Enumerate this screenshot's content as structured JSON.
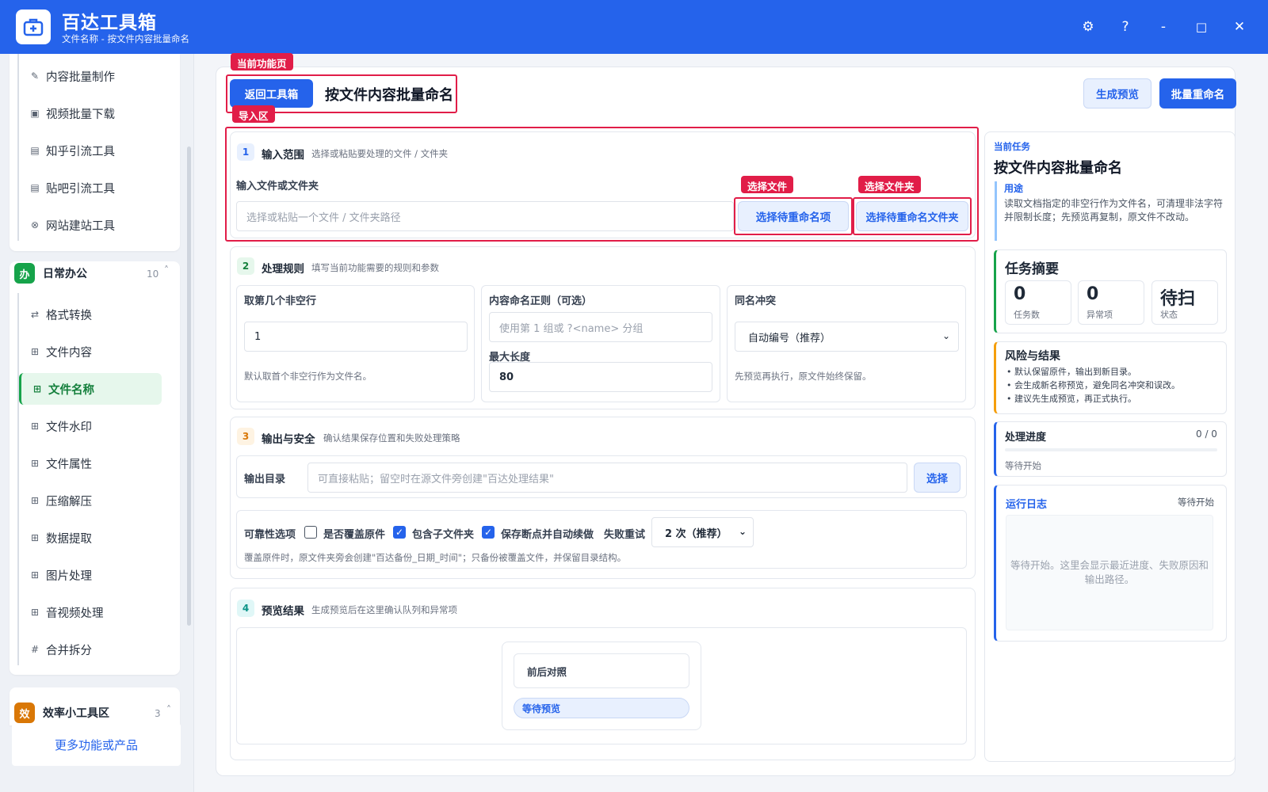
{
  "app": {
    "title": "百达工具箱",
    "subtitle": "文件名称 - 按文件内容批量命名"
  },
  "window_controls": {
    "settings": "⚙",
    "help": "?",
    "minimize": "-",
    "maximize": "□",
    "close": "✕"
  },
  "sidebar": {
    "group1_items": [
      {
        "label": "内容批量制作",
        "icon": "pen-icon",
        "glyph": "✎"
      },
      {
        "label": "视频批量下载",
        "icon": "video-icon",
        "glyph": "▣"
      },
      {
        "label": "知乎引流工具",
        "icon": "zhihu-icon",
        "glyph": "▤"
      },
      {
        "label": "贴吧引流工具",
        "icon": "tieba-icon",
        "glyph": "▤"
      },
      {
        "label": "网站建站工具",
        "icon": "globe-icon",
        "glyph": "⊗"
      }
    ],
    "office": {
      "badge": "办",
      "label": "日常办公",
      "count": "10",
      "caret": "˄",
      "items": [
        {
          "label": "格式转换",
          "glyph": "⇄"
        },
        {
          "label": "文件内容",
          "glyph": "⊞"
        },
        {
          "label": "文件名称",
          "glyph": "⊞"
        },
        {
          "label": "文件水印",
          "glyph": "⊞"
        },
        {
          "label": "文件属性",
          "glyph": "⊞"
        },
        {
          "label": "压缩解压",
          "glyph": "⊞"
        },
        {
          "label": "数据提取",
          "glyph": "⊞"
        },
        {
          "label": "图片处理",
          "glyph": "⊞"
        },
        {
          "label": "音视频处理",
          "glyph": "⊞"
        },
        {
          "label": "合并拆分",
          "glyph": "#"
        }
      ]
    },
    "efficiency": {
      "badge": "效",
      "label": "效率小工具区",
      "count": "3",
      "caret": "˄"
    },
    "more_link": "更多功能或产品"
  },
  "annotations": {
    "current_page": "当前功能页",
    "import_area": "导入区",
    "select_file": "选择文件",
    "select_folder": "选择文件夹"
  },
  "header": {
    "back_button": "返回工具箱",
    "page_title": "按文件内容批量命名",
    "preview_button": "生成预览",
    "rename_button": "批量重命名"
  },
  "section1": {
    "num": "1",
    "title": "输入范围",
    "desc": "选择或粘贴要处理的文件 / 文件夹",
    "field_label": "输入文件或文件夹",
    "placeholder": "选择或粘贴一个文件 / 文件夹路径",
    "select_items_button": "选择待重命名项",
    "select_folder_button": "选择待重命名文件夹"
  },
  "section2": {
    "num": "2",
    "title": "处理规则",
    "desc": "填写当前功能需要的规则和参数",
    "nonempty_label": "取第几个非空行",
    "nonempty_value": "1",
    "nonempty_hint": "默认取首个非空行作为文件名。",
    "regex_label": "内容命名正则（可选）",
    "regex_placeholder": "使用第 1 组或 ?<name> 分组",
    "maxlen_label": "最大长度",
    "maxlen_value": "80",
    "conflict_label": "同名冲突",
    "conflict_value": "自动编号（推荐）",
    "conflict_hint": "先预览再执行，原文件始终保留。"
  },
  "section3": {
    "num": "3",
    "title": "输出与安全",
    "desc": "确认结果保存位置和失败处理策略",
    "outdir_label": "输出目录",
    "outdir_placeholder": "可直接粘贴；留空时在源文件旁创建\"百达处理结果\"",
    "outdir_button": "选择",
    "reliability_label": "可靠性选项",
    "overwrite_label": "是否覆盖原件",
    "subfolder_label": "包含子文件夹",
    "resume_label": "保存断点并自动续做",
    "retry_label": "失败重试",
    "retry_value": "2 次（推荐）",
    "backup_hint": "覆盖原件时，原文件夹旁会创建\"百达备份_日期_时间\"；只备份被覆盖文件，并保留目录结构。"
  },
  "section4": {
    "num": "4",
    "title": "预览结果",
    "desc": "生成预览后在这里确认队列和异常项",
    "compare_label": "前后对照",
    "status_pill": "等待预览"
  },
  "right_panel": {
    "current_task_label": "当前任务",
    "task_title": "按文件内容批量命名",
    "purpose_label": "用途",
    "purpose_text": "读取文档指定的非空行作为文件名，可清理非法字符并限制长度；先预览再复制，原文件不改动。",
    "summary_title": "任务摘要",
    "stats": [
      {
        "value": "0",
        "label": "任务数"
      },
      {
        "value": "0",
        "label": "异常项"
      },
      {
        "value": "待扫",
        "label": "状态"
      }
    ],
    "risk_title": "风险与结果",
    "risk_items": [
      "默认保留原件，输出到新目录。",
      "会生成新名称预览，避免同名冲突和误改。",
      "建议先生成预览，再正式执行。"
    ],
    "progress_title": "处理进度",
    "progress_count": "0 / 0",
    "progress_fraction": 0,
    "progress_status": "等待开始",
    "log_title": "运行日志",
    "log_status": "等待开始",
    "log_text": "等待开始。这里会显示最近进度、失败原因和输出路径。"
  },
  "colors": {
    "primary": "#2563eb",
    "annotation": "#e11d48",
    "active_green": "#16a34a",
    "orange": "#f59e0b"
  }
}
